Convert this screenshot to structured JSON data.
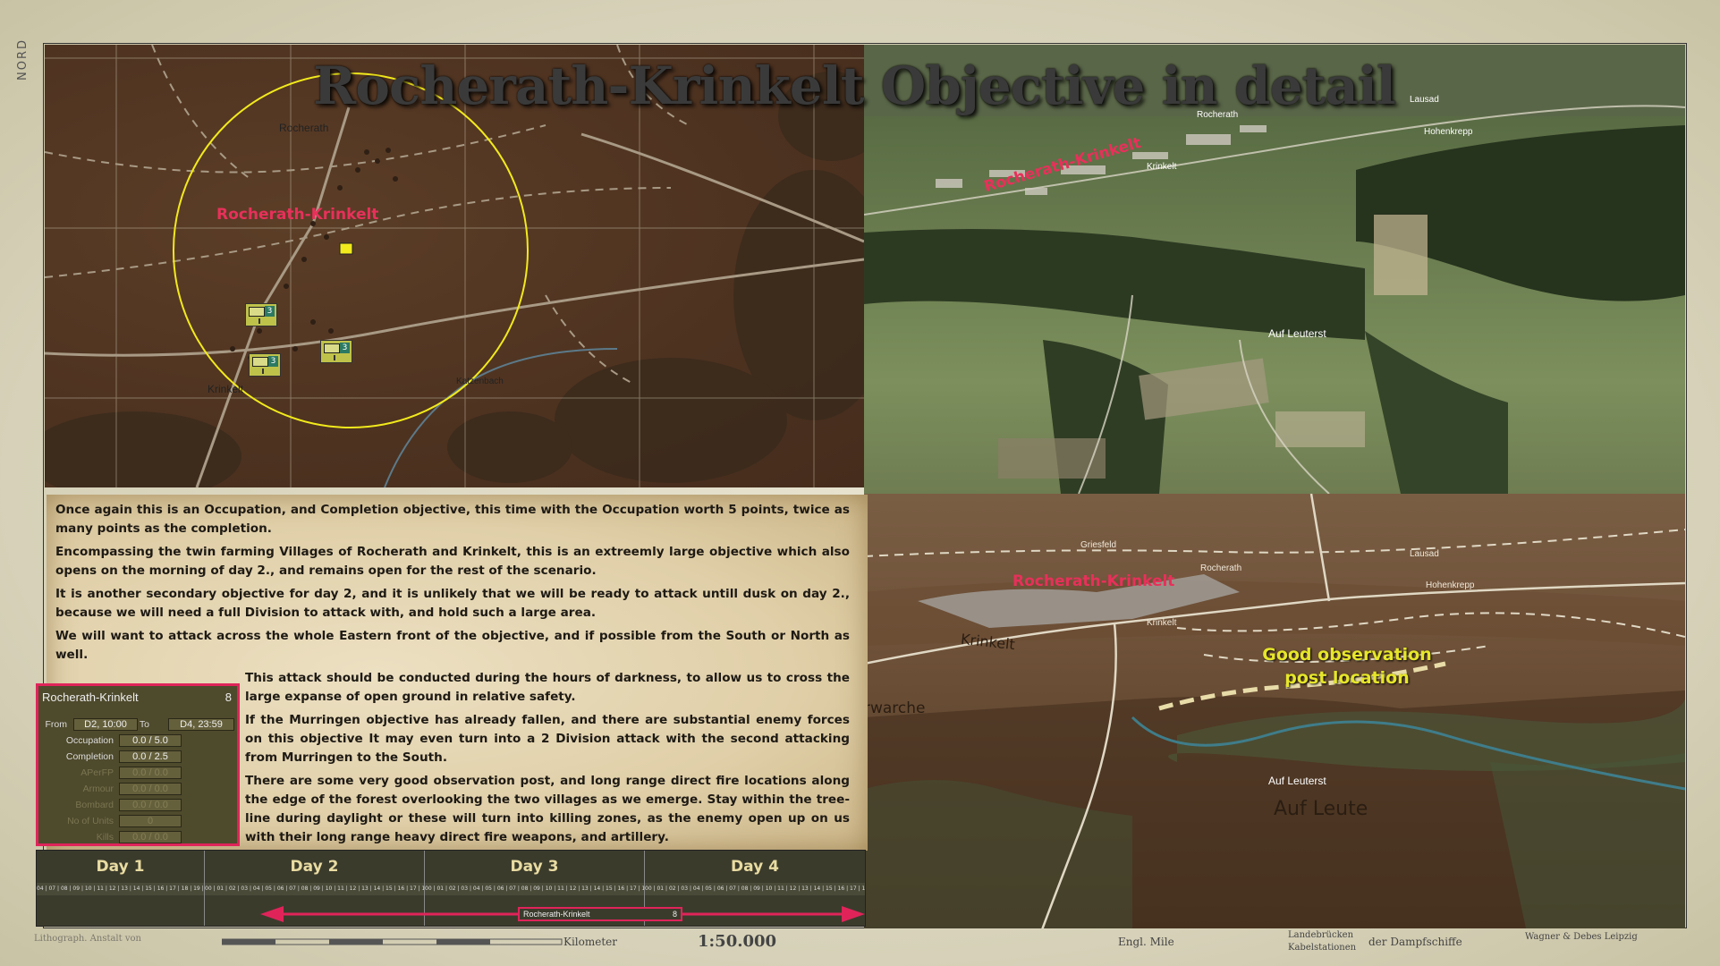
{
  "title": "Rocherath-Krinkelt Objective in detail",
  "map_margin": {
    "north_label": "NORD"
  },
  "left_map": {
    "objective_label": "Rocherath-Krinkelt",
    "place_labels": [
      "Rocherath",
      "Krinkelt",
      "Katzenbach"
    ],
    "units": [
      {
        "strength": "3",
        "icon": "recon-unit-icon"
      },
      {
        "strength": "3",
        "icon": "mech-infantry-unit-icon"
      },
      {
        "strength": "3",
        "icon": "recon-unit-icon"
      }
    ],
    "circle_color": "#f2ea1c"
  },
  "satellite": {
    "objective_label": "Rocherath-Krinkelt",
    "place_labels": [
      "Rocherath",
      "Krinkelt",
      "Auf Leuterst",
      "Hohenkrepp",
      "Lausad"
    ]
  },
  "terrain_view": {
    "objective_label": "Rocherath-Krinkelt",
    "place_labels": [
      "Griesfeld",
      "Rocherath",
      "Krinkelt",
      "Hohenkrepp",
      "Lausad",
      "Auf Leuterst"
    ],
    "terrain_text": [
      "Krinkelt",
      "Auf Leute",
      "rwarche"
    ],
    "callout": [
      "Good observation",
      "post location"
    ]
  },
  "briefing": [
    "Once again this is an Occupation, and Completion objective, this time with the Occupation worth 5 points, twice as many points as the completion.",
    "Encompassing the twin farming Villages of Rocherath and Krinkelt, this is an extreemly large objective which also opens on the morning of day 2., and remains open for the rest of the scenario.",
    "It is another secondary objective for day 2, and it is unlikely that we will be ready to attack untill dusk on day 2., because we will need a full Division to attack with, and hold such a large area.",
    "We will want to attack across the whole Eastern front of the objective, and if possible from the South or North as well.",
    "This attack should be conducted during the hours of darkness, to allow us to cross the large expanse of open ground in relative safety.",
    "If the Murringen objective has already fallen, and there are substantial enemy forces on this objective It may even turn into a 2 Division attack with the second attacking from Murringen to the South.",
    "There are some very good observation post, and long range direct fire locations along the edge of the forest overlooking the two villages as we emerge. Stay within the tree-line during daylight or these will turn into killing zones, as the enemy open up on us with their long range heavy direct fire weapons, and artillery."
  ],
  "objective_panel": {
    "name": "Rocherath-Krinkelt",
    "value": "8",
    "from_label": "From",
    "from": "D2, 10:00",
    "to_label": "To",
    "to": "D4, 23:59",
    "rows": [
      {
        "label": "Occupation",
        "value": "0.0 / 5.0",
        "active": true
      },
      {
        "label": "Completion",
        "value": "0.0 / 2.5",
        "active": true
      },
      {
        "label": "APerFP",
        "value": "0.0 / 0.0",
        "active": false
      },
      {
        "label": "Armour",
        "value": "0.0 / 0.0",
        "active": false
      },
      {
        "label": "Bombard",
        "value": "0.0 / 0.0",
        "active": false
      },
      {
        "label": "No of Units",
        "value": "0",
        "active": false
      },
      {
        "label": "Kills",
        "value": "0.0 / 0.0",
        "active": false
      }
    ]
  },
  "timeline": {
    "days": [
      "Day 1",
      "Day 2",
      "Day 3",
      "Day 4"
    ],
    "day1_hours": "04 | 07 | 08 | 09 | 10 | 11 | 12 | 13 | 14 | 15 | 16 | 17 | 18 | 19 | 20 | 21 | 22 | 23",
    "day_hours": "00 | 01 | 02 | 03 | 04 | 05 | 06 | 07 | 08 | 09 | 10 | 11 | 12 | 13 | 14 | 15 | 16 | 17 | 18 | 19 | 20 | 21 | 22 | 23",
    "bar_label": "Rocherath-Krinkelt",
    "bar_value": "8",
    "arrow_color": "#e0245a"
  },
  "map_footer": {
    "scale": "1:50.000",
    "km_label": "Kilometer",
    "mile_label": "Engl. Mile",
    "legend_a": "Landebrücken",
    "legend_b": "Kabelstationen",
    "legend_c": "der Dampfschiffe",
    "publisher": "Wagner & Debes Leipzig",
    "engraver": "Lithograph. Anstalt von"
  }
}
